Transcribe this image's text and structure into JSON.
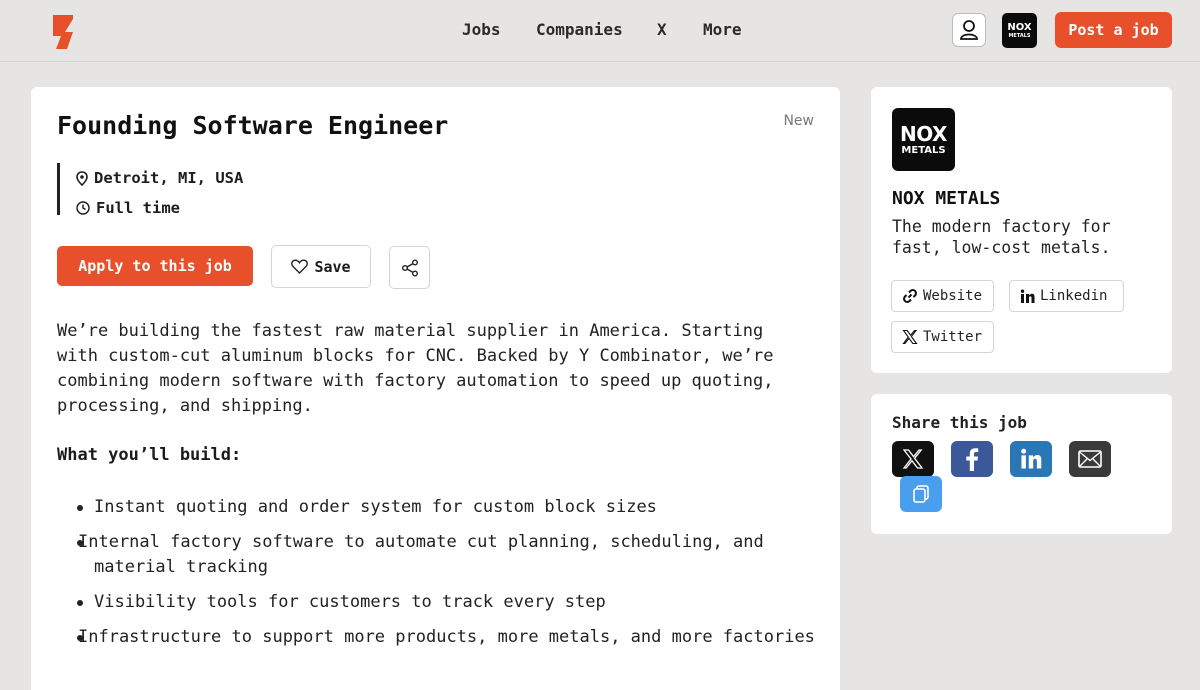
{
  "header": {
    "nav": [
      "Jobs",
      "Companies",
      "X",
      "More"
    ],
    "company_logo_line1": "NOX",
    "company_logo_line2": "METALS",
    "post_job_label": "Post a job"
  },
  "job": {
    "title": "Founding Software Engineer",
    "badge": "New",
    "location": "Detroit, MI, USA",
    "type": "Full time",
    "apply_label": "Apply to this job",
    "save_label": "Save",
    "description": "We’re building the fastest raw material supplier in America. Starting with custom-cut aluminum blocks for CNC. Backed by Y Combinator, we’re combining modern software with factory automation to speed up quoting, processing, and shipping.",
    "section_heading": "What you’ll build:",
    "bullets": [
      "Instant quoting and order system for custom block sizes",
      "Internal factory software to automate cut planning, scheduling, and material tracking",
      "Visibility tools for customers to track every step",
      "Infrastructure to support more products, more metals, and more factories"
    ]
  },
  "company": {
    "logo_line1": "NOX",
    "logo_line2": "METALS",
    "name": "NOX METALS",
    "tagline": "The modern factory for fast, low-cost metals.",
    "links": [
      "Website",
      "Linkedin",
      "Twitter"
    ]
  },
  "share": {
    "heading": "Share this job"
  },
  "colors": {
    "accent": "#e8502b",
    "background": "#e6e5e3",
    "facebook": "#3b5998",
    "linkedin": "#2a77b5",
    "email": "#3a3a3a",
    "copy": "#4a9ef0"
  }
}
